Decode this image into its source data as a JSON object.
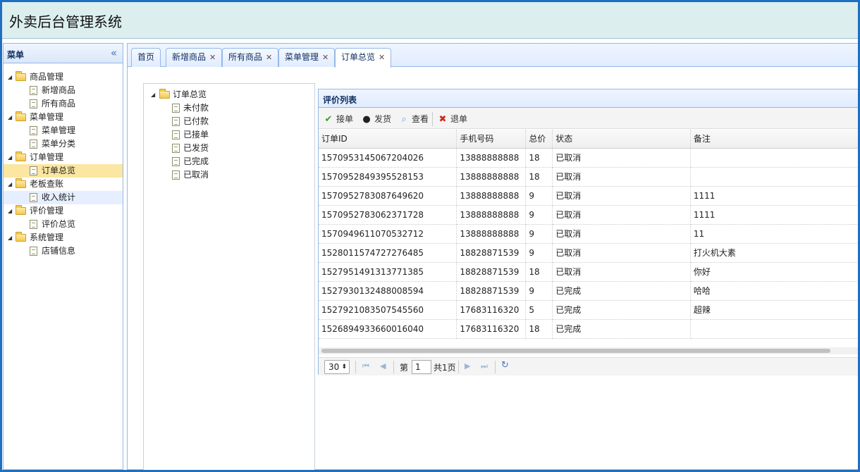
{
  "header": {
    "title": "外卖后台管理系统"
  },
  "menu": {
    "title": "菜单",
    "collapse_glyph": "«",
    "groups": [
      {
        "label": "商品管理",
        "items": [
          {
            "label": "新增商品"
          },
          {
            "label": "所有商品"
          }
        ]
      },
      {
        "label": "菜单管理",
        "items": [
          {
            "label": "菜单管理"
          },
          {
            "label": "菜单分类"
          }
        ]
      },
      {
        "label": "订单管理",
        "items": [
          {
            "label": "订单总览"
          }
        ]
      },
      {
        "label": "老板查账",
        "items": [
          {
            "label": "收入统计"
          }
        ]
      },
      {
        "label": "评价管理",
        "items": [
          {
            "label": "评价总览"
          }
        ]
      },
      {
        "label": "系统管理",
        "items": [
          {
            "label": "店铺信息"
          }
        ]
      }
    ]
  },
  "tabs": [
    {
      "label": "首页"
    },
    {
      "label": "新增商品"
    },
    {
      "label": "所有商品"
    },
    {
      "label": "菜单管理"
    },
    {
      "label": "订单总览"
    }
  ],
  "order_tree": {
    "root": "订单总览",
    "items": [
      {
        "label": "未付款"
      },
      {
        "label": "已付款"
      },
      {
        "label": "已接单"
      },
      {
        "label": "已发货"
      },
      {
        "label": "已完成"
      },
      {
        "label": "已取消"
      }
    ]
  },
  "grid": {
    "title": "评价列表",
    "toolbar": {
      "accept": "接单",
      "ship": "发货",
      "view": "查看",
      "reject": "退单"
    },
    "columns": {
      "id": "订单ID",
      "phone": "手机号码",
      "total": "总价",
      "status": "状态",
      "note": "备注"
    },
    "rows": [
      {
        "id": "1570953145067204026",
        "phone": "13888888888",
        "total": "18",
        "status": "已取消",
        "note": ""
      },
      {
        "id": "1570952849395528153",
        "phone": "13888888888",
        "total": "18",
        "status": "已取消",
        "note": ""
      },
      {
        "id": "1570952783087649620",
        "phone": "13888888888",
        "total": "9",
        "status": "已取消",
        "note": "1111"
      },
      {
        "id": "1570952783062371728",
        "phone": "13888888888",
        "total": "9",
        "status": "已取消",
        "note": "1111"
      },
      {
        "id": "1570949611070532712",
        "phone": "13888888888",
        "total": "9",
        "status": "已取消",
        "note": "11"
      },
      {
        "id": "1528011574727276485",
        "phone": "18828871539",
        "total": "9",
        "status": "已取消",
        "note": "打火机大素"
      },
      {
        "id": "1527951491313771385",
        "phone": "18828871539",
        "total": "18",
        "status": "已取消",
        "note": "你好"
      },
      {
        "id": "1527930132488008594",
        "phone": "18828871539",
        "total": "9",
        "status": "已完成",
        "note": "哈哈"
      },
      {
        "id": "1527921083507545560",
        "phone": "17683116320",
        "total": "5",
        "status": "已完成",
        "note": "超辣"
      },
      {
        "id": "1526894933660016040",
        "phone": "17683116320",
        "total": "18",
        "status": "已完成",
        "note": ""
      }
    ],
    "pager": {
      "page_size": "30",
      "page_label_before": "第",
      "page_value": "1",
      "page_label_after": "共1页"
    }
  },
  "colors": {
    "canceled": "#f2e14a",
    "completed": "#8a1a2a",
    "accent": "#95b8e7"
  }
}
